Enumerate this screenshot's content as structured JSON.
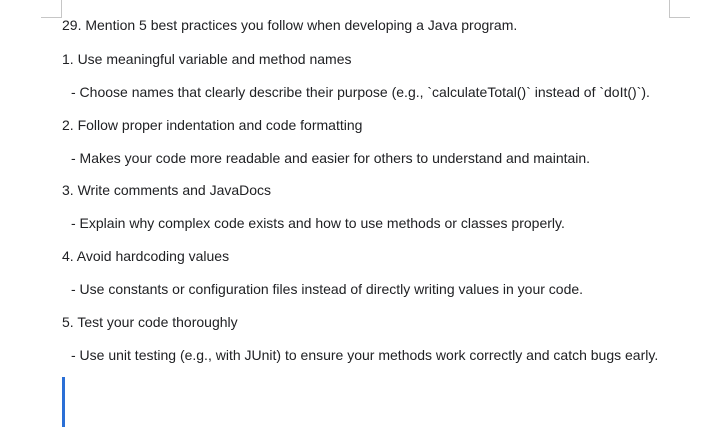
{
  "document": {
    "heading": "29. Mention 5 best practices you follow when developing a Java program.",
    "items": [
      {
        "title": "1. Use meaningful variable and method names",
        "detail": "- Choose names that clearly describe their purpose (e.g., `calculateTotal()` instead of `doIt()`)."
      },
      {
        "title": "2. Follow proper indentation and code formatting",
        "detail": "- Makes your code more readable and easier for others to understand and maintain."
      },
      {
        "title": "3. Write comments and JavaDocs",
        "detail": "- Explain why complex code exists and how to use methods or classes properly."
      },
      {
        "title": "4. Avoid hardcoding values",
        "detail": "- Use constants or configuration files instead of directly writing values in your code."
      },
      {
        "title": "5. Test your code thoroughly",
        "detail": "- Use unit testing (e.g., with JUnit) to ensure your methods work correctly and catch bugs early."
      }
    ]
  },
  "colors": {
    "text": "#202124",
    "cursor": "#2a6fd6",
    "page_corner_marks": "#c6c6c6"
  }
}
